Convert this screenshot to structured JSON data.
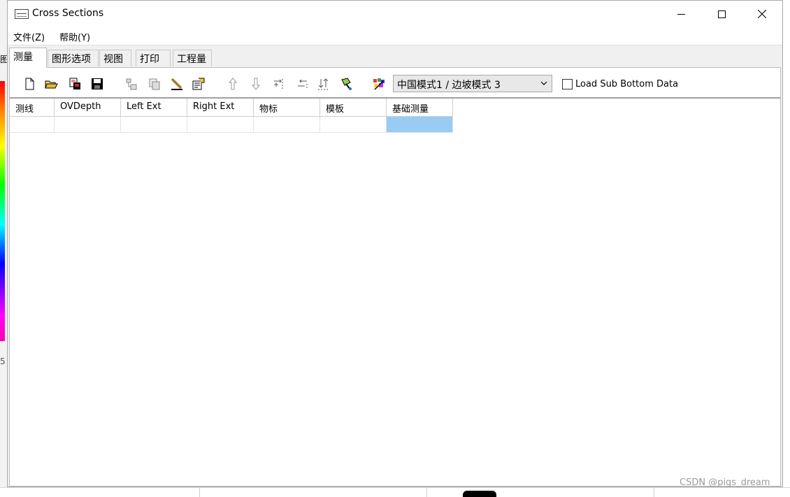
{
  "window": {
    "title": "Cross Sections",
    "controls": {
      "minimize": "minimize",
      "maximize": "maximize",
      "close": "close"
    }
  },
  "menu": {
    "file": "文件(Z)",
    "help": "帮助(Y)"
  },
  "tabs": [
    {
      "label": "测量",
      "active": true
    },
    {
      "label": "图形选项",
      "active": false
    },
    {
      "label": "视图",
      "active": false
    },
    {
      "label": "打印",
      "active": false
    },
    {
      "label": "工程量",
      "active": false
    }
  ],
  "toolbar": {
    "icons": [
      "new-file-icon",
      "open-folder-icon",
      "export-icon",
      "save-icon",
      "insert-station-icon",
      "copy-station-icon",
      "edit-pencil-icon",
      "properties-icon",
      "arrow-up-icon",
      "arrow-down-icon",
      "add-right-icon",
      "add-left-icon",
      "sort-icon",
      "paint-icon",
      "palette-icon"
    ],
    "mode_select": "中国模式1 / 边坡模式 3",
    "load_sub_bottom": {
      "label": "Load Sub Bottom Data",
      "checked": false
    }
  },
  "grid": {
    "columns": [
      "测线",
      "OVDepth",
      "Left Ext",
      "Right Ext",
      "物标",
      "模板",
      "基础测量"
    ],
    "rows": [
      [
        "",
        "",
        "",
        "",
        "",
        "",
        ""
      ]
    ],
    "selected_cell": {
      "row": 0,
      "col": 6
    }
  },
  "background": {
    "left_glyph": "图",
    "left_glyph2": "5"
  },
  "watermark": "CSDN @pigs_dream",
  "colors": {
    "selection": "#99ccf5",
    "panel_bg": "#ffffff",
    "window_bg": "#f0f0f0"
  }
}
